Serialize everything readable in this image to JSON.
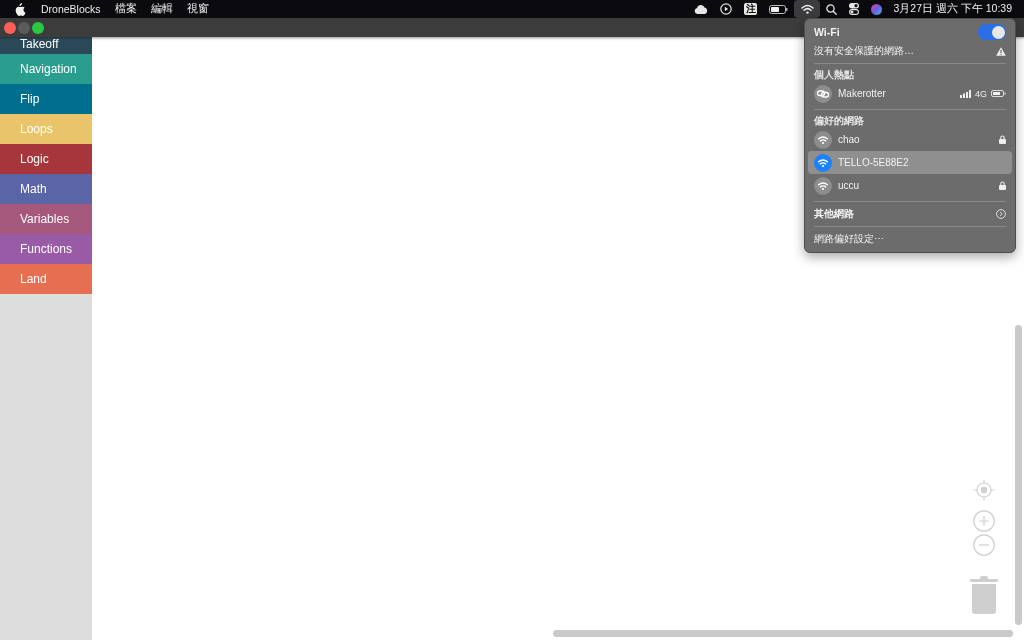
{
  "menu_bar": {
    "app_name": "DroneBlocks",
    "menus": [
      "檔案",
      "編輯",
      "視窗"
    ],
    "status_items": [
      {
        "kind": "cloud",
        "selected": false
      },
      {
        "kind": "media",
        "selected": false
      },
      {
        "kind": "input-method",
        "label": "注",
        "selected": false
      },
      {
        "kind": "battery",
        "selected": false
      },
      {
        "kind": "wifi",
        "selected": true
      },
      {
        "kind": "search",
        "selected": false
      },
      {
        "kind": "control-center",
        "selected": false
      },
      {
        "kind": "siri",
        "selected": false
      }
    ],
    "clock": "3月27日 週六 下午 10:39"
  },
  "window": {
    "controls": [
      {
        "kind": "close",
        "disabled": false
      },
      {
        "kind": "minimize",
        "disabled": true
      },
      {
        "kind": "zoom",
        "disabled": false
      }
    ]
  },
  "sidebar": {
    "categories": [
      {
        "label": "Takeoff",
        "color": "#2b4856"
      },
      {
        "label": "Navigation",
        "color": "#2a9d8f"
      },
      {
        "label": "Flip",
        "color": "#006e8f"
      },
      {
        "label": "Loops",
        "color": "#e9c46a"
      },
      {
        "label": "Logic",
        "color": "#a6363b"
      },
      {
        "label": "Math",
        "color": "#5a64a6"
      },
      {
        "label": "Variables",
        "color": "#a5587c"
      },
      {
        "label": "Functions",
        "color": "#995ba6"
      },
      {
        "label": "Land",
        "color": "#e76f51"
      }
    ]
  },
  "wifi_menu": {
    "title": "Wi-Fi",
    "on": true,
    "unsecured_notice": "沒有安全保護的網路…",
    "sections": [
      {
        "heading": "個人熱點",
        "networks": [
          {
            "kind": "hotspot",
            "name": "Makerotter",
            "network_type": "4G",
            "locked": false,
            "selected": false
          }
        ]
      },
      {
        "heading": "偏好的網路",
        "networks": [
          {
            "kind": "wifi",
            "name": "chao",
            "locked": true,
            "selected": false
          },
          {
            "kind": "wifi",
            "name": "TELLO-5E88E2",
            "locked": false,
            "selected": true
          },
          {
            "kind": "wifi",
            "name": "uccu",
            "locked": true,
            "selected": false
          }
        ]
      }
    ],
    "other_networks": "其他網路",
    "preferences": "網路偏好設定⋯"
  }
}
